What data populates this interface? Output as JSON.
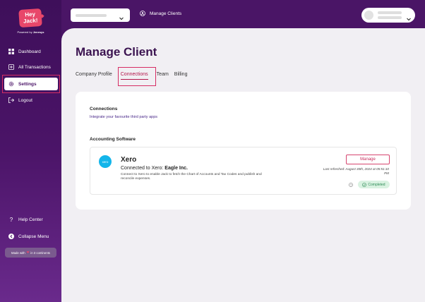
{
  "brand": {
    "logo_line1": "Hey",
    "logo_line2": "Jack!",
    "powered_prefix": "Powered by",
    "powered_brand": "Jenesys"
  },
  "sidebar": {
    "items": [
      {
        "label": "Dashboard",
        "icon": "dashboard-icon"
      },
      {
        "label": "All Transactions",
        "icon": "transactions-icon"
      },
      {
        "label": "Settings",
        "icon": "gear-icon",
        "active": true
      },
      {
        "label": "Logout",
        "icon": "logout-icon"
      }
    ],
    "bottom": [
      {
        "label": "Help Center",
        "icon": "question-icon"
      },
      {
        "label": "Collapse Menu",
        "icon": "collapse-icon"
      }
    ],
    "made_with_prefix": "Made with",
    "made_with_suffix": "in 3 continents"
  },
  "header": {
    "manage_clients_label": "Manage Clients"
  },
  "page": {
    "title": "Manage Client",
    "tabs": [
      {
        "label": "Company Profile"
      },
      {
        "label": "Connections",
        "active": true
      },
      {
        "label": "Team"
      },
      {
        "label": "Billing"
      }
    ]
  },
  "connections": {
    "title": "Connections",
    "subtitle": "Integrate your favourite third party apps",
    "accounting_title": "Accounting Software",
    "xero": {
      "logo_text": "xero",
      "name": "Xero",
      "connected_prefix": "Connected to Xero:",
      "connected_company": "Eagle Inc.",
      "description": "Connect to Xero to enable Jack to fetch the Chart of Accounts and Tax Codes and publish and reconcile expenses.",
      "manage_label": "Manage",
      "last_refreshed": "Last refreshed: August 30th, 2024 at 05:51:10 PM",
      "status": "Completed"
    }
  },
  "colors": {
    "sidebar_bg": "#4b1468",
    "accent": "#d62d63",
    "title": "#3b1350",
    "xero_blue": "#13b5ea",
    "status_green": "#2e8b57"
  }
}
